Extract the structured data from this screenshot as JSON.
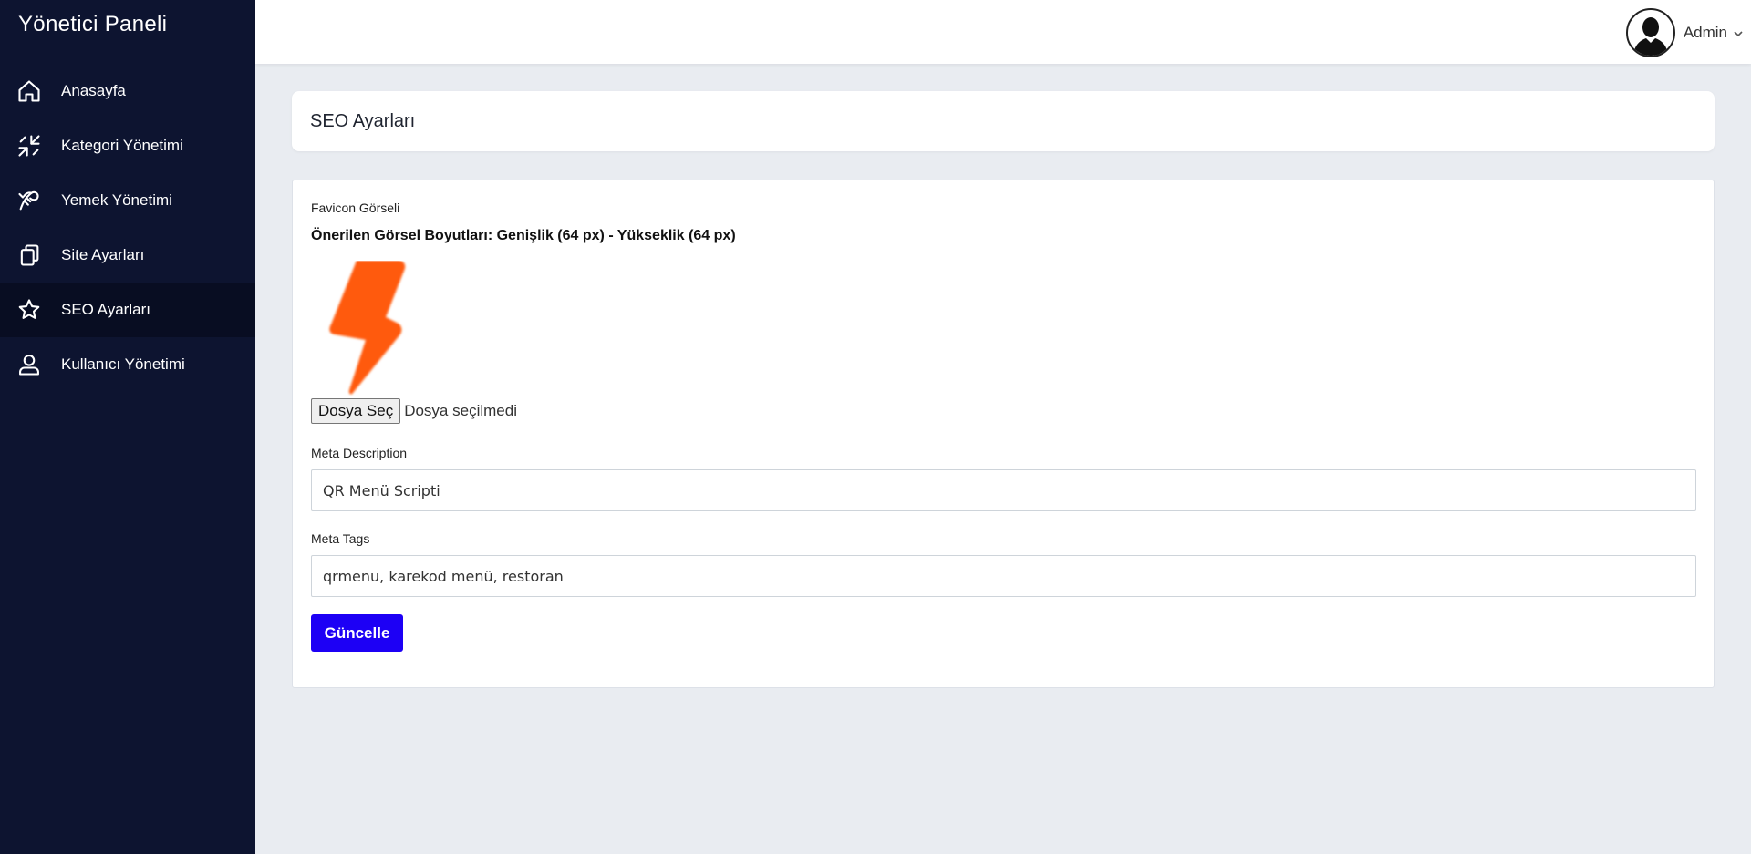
{
  "sidebar": {
    "brand": "Yönetici Paneli",
    "items": [
      {
        "label": "Anasayfa",
        "icon": "home-icon"
      },
      {
        "label": "Kategori Yönetimi",
        "icon": "category-arrows-icon"
      },
      {
        "label": "Yemek Yönetimi",
        "icon": "food-icon"
      },
      {
        "label": "Site Ayarları",
        "icon": "copy-icon"
      },
      {
        "label": "SEO Ayarları",
        "icon": "star-icon",
        "active": true
      },
      {
        "label": "Kullanıcı Yönetimi",
        "icon": "user-icon"
      }
    ]
  },
  "topbar": {
    "user_name": "Admin",
    "avatar_icon": "user-avatar-icon",
    "dropdown_icon": "chevron-down-icon"
  },
  "page": {
    "title": "SEO Ayarları"
  },
  "form": {
    "favicon_label": "Favicon Görseli",
    "favicon_hint": "Önerilen Görsel Boyutları: Genişlik (64 px) - Yükseklik (64 px)",
    "favicon_icon": "lightning-bolt-icon",
    "file_button": "Dosya Seç",
    "file_status": "Dosya seçilmedi",
    "meta_description_label": "Meta Description",
    "meta_description_value": "QR Menü Scripti",
    "meta_tags_label": "Meta Tags",
    "meta_tags_value": "qrmenu, karekod menü, restoran",
    "submit_label": "Güncelle"
  },
  "colors": {
    "sidebar_bg": "#0d1430",
    "sidebar_active_bg": "#080d22",
    "content_bg": "#e9ecf1",
    "primary_button": "#1d00f5",
    "favicon_orange": "#ff5a0a"
  }
}
